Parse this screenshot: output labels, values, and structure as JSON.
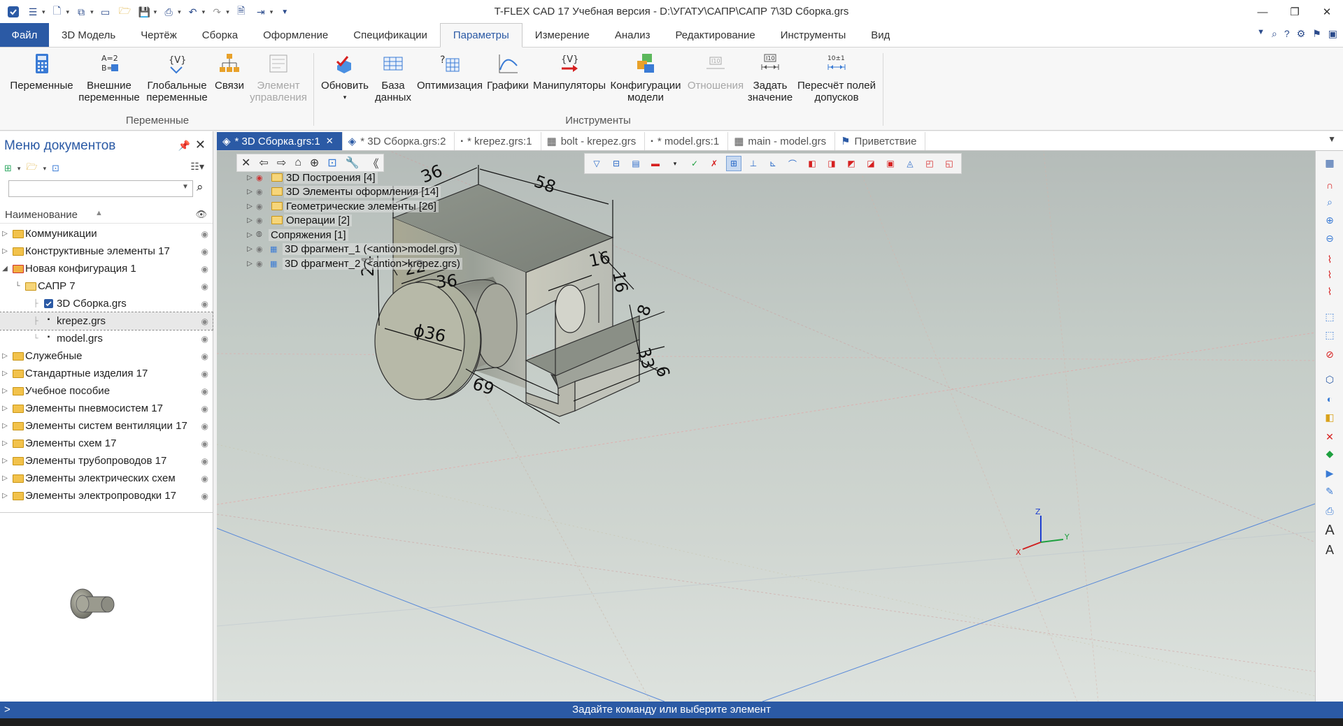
{
  "window": {
    "title": "T-FLEX CAD 17 Учебная версия - D:\\УГАТУ\\САПР\\САПР 7\\3D Сборка.grs"
  },
  "ribbon_tabs": {
    "file": "Файл",
    "items": [
      "3D Модель",
      "Чертёж",
      "Сборка",
      "Оформление",
      "Спецификации",
      "Параметры",
      "Измерение",
      "Анализ",
      "Редактирование",
      "Инструменты",
      "Вид"
    ],
    "active": "Параметры"
  },
  "ribbon": {
    "variables": {
      "line1": "Переменные"
    },
    "external_vars": {
      "line1": "Внешние",
      "line2": "переменные"
    },
    "global_vars": {
      "line1": "Глобальные",
      "line2": "переменные"
    },
    "links": {
      "line1": "Связи"
    },
    "control_element": {
      "line1": "Элемент",
      "line2": "управления"
    },
    "group_variables": "Переменные",
    "update": {
      "line1": "Обновить"
    },
    "database": {
      "line1": "База",
      "line2": "данных"
    },
    "optimization": {
      "line1": "Оптимизация"
    },
    "graphs": {
      "line1": "Графики"
    },
    "manipulators": {
      "line1": "Манипуляторы"
    },
    "configurations": {
      "line1": "Конфигурации",
      "line2": "модели"
    },
    "relations": {
      "line1": "Отношения"
    },
    "set_value": {
      "line1": "Задать",
      "line2": "значение"
    },
    "recalc_tolerance": {
      "line1": "Пересчёт полей",
      "line2": "допусков"
    },
    "group_tools": "Инструменты"
  },
  "left_panel": {
    "title": "Меню документов",
    "header_label": "Наименование",
    "tree": [
      {
        "label": "Коммуникации"
      },
      {
        "label": "Конструктивные элементы 17"
      },
      {
        "label": "Новая конфигурация 1"
      },
      {
        "label": "САПР 7"
      },
      {
        "label": "3D Сборка.grs"
      },
      {
        "label": "krepez.grs"
      },
      {
        "label": "model.grs"
      },
      {
        "label": "Служебные"
      },
      {
        "label": "Стандартные изделия 17"
      },
      {
        "label": "Учебное пособие"
      },
      {
        "label": "Элементы пневмосистем 17"
      },
      {
        "label": "Элементы систем вентиляции 17"
      },
      {
        "label": "Элементы схем 17"
      },
      {
        "label": "Элементы трубопроводов 17"
      },
      {
        "label": "Элементы электрических схем"
      },
      {
        "label": "Элементы электропроводки 17"
      }
    ]
  },
  "doc_tabs": [
    {
      "label": "* 3D Сборка.grs:1",
      "active": true
    },
    {
      "label": "* 3D Сборка.grs:2"
    },
    {
      "label": "* krepez.grs:1"
    },
    {
      "label": "bolt - krepez.grs"
    },
    {
      "label": "* model.grs:1"
    },
    {
      "label": "main - model.grs"
    },
    {
      "label": "Приветствие"
    }
  ],
  "model_tree": [
    {
      "label": "3D Построения [4]"
    },
    {
      "label": "3D Элементы оформления [14]"
    },
    {
      "label": "Геометрические элементы [26]"
    },
    {
      "label": "Операции [2]"
    },
    {
      "label": "Сопряжения [1]"
    },
    {
      "label": "3D фрагмент_1 (<antion>model.grs)"
    },
    {
      "label": "3D фрагмент_2 (<antion>krepez.grs)"
    }
  ],
  "dimensions": {
    "d36": "36",
    "d58": "58",
    "d16a": "16",
    "d16b": "16",
    "d24": "24",
    "d22": "22",
    "d36b": "36",
    "phi36": "ϕ36",
    "d8": "8",
    "d33": "33",
    "d6": "6",
    "d69": "69"
  },
  "axes": {
    "x": "X",
    "y": "Y",
    "z": "Z"
  },
  "status": {
    "prompt": ">",
    "text": "Задайте команду или выберите элемент"
  },
  "colors": {
    "accent": "#2b5aa5",
    "viewport_top": "#b5bcb9",
    "viewport_bottom": "#dde2de"
  }
}
